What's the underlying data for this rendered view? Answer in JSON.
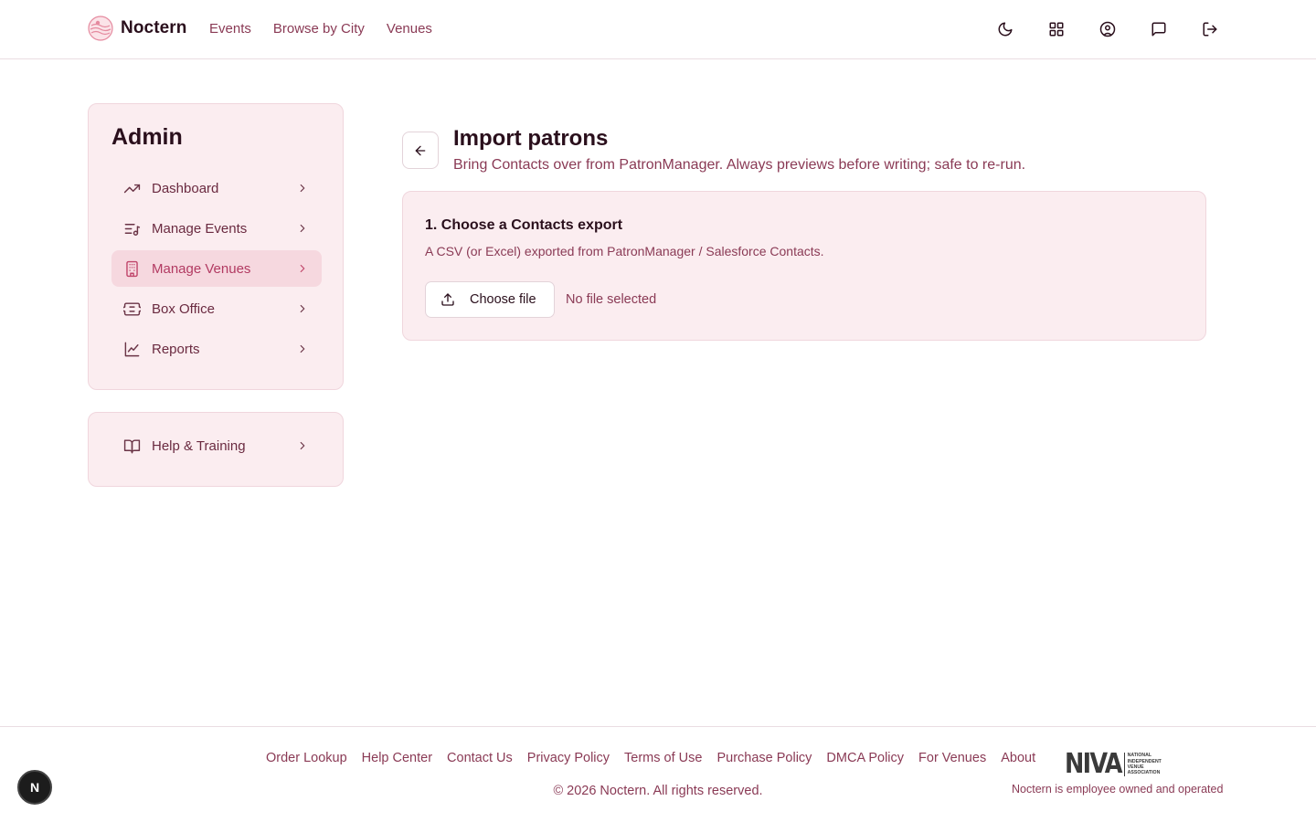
{
  "header": {
    "brand": "Noctern",
    "nav": [
      "Events",
      "Browse by City",
      "Venues"
    ],
    "icons": [
      "moon-icon",
      "grid-icon",
      "user-circle-icon",
      "message-icon",
      "logout-icon"
    ]
  },
  "sidebar": {
    "title": "Admin",
    "items": [
      {
        "label": "Dashboard",
        "icon": "trend-icon",
        "active": false
      },
      {
        "label": "Manage Events",
        "icon": "music-list-icon",
        "active": false
      },
      {
        "label": "Manage Venues",
        "icon": "building-icon",
        "active": true
      },
      {
        "label": "Box Office",
        "icon": "ticket-icon",
        "active": false
      },
      {
        "label": "Reports",
        "icon": "chart-line-icon",
        "active": false
      }
    ],
    "help": {
      "label": "Help & Training",
      "icon": "book-icon"
    }
  },
  "main": {
    "title": "Import patrons",
    "subtitle": "Bring Contacts over from PatronManager. Always previews before writing; safe to re-run.",
    "step": {
      "title": "1. Choose a Contacts export",
      "description": "A CSV (or Excel) exported from PatronManager / Salesforce Contacts.",
      "button_label": "Choose file",
      "file_status": "No file selected"
    }
  },
  "footer": {
    "links": [
      "Order Lookup",
      "Help Center",
      "Contact Us",
      "Privacy Policy",
      "Terms of Use",
      "Purchase Policy",
      "DMCA Policy",
      "For Venues",
      "About"
    ],
    "copyright": "© 2026 Noctern. All rights reserved.",
    "niva": {
      "word": "NIVA",
      "lines": [
        "NATIONAL",
        "INDEPENDENT",
        "VENUE",
        "ASSOCIATION"
      ]
    },
    "employee_note": "Noctern is employee owned and operated"
  },
  "badge": "N",
  "colors": {
    "accent": "#c0466b",
    "card_bg": "#fbedf0",
    "active_bg": "#f6d8df",
    "text_dark": "#2a0f1c",
    "text_muted": "#8a3a55"
  }
}
